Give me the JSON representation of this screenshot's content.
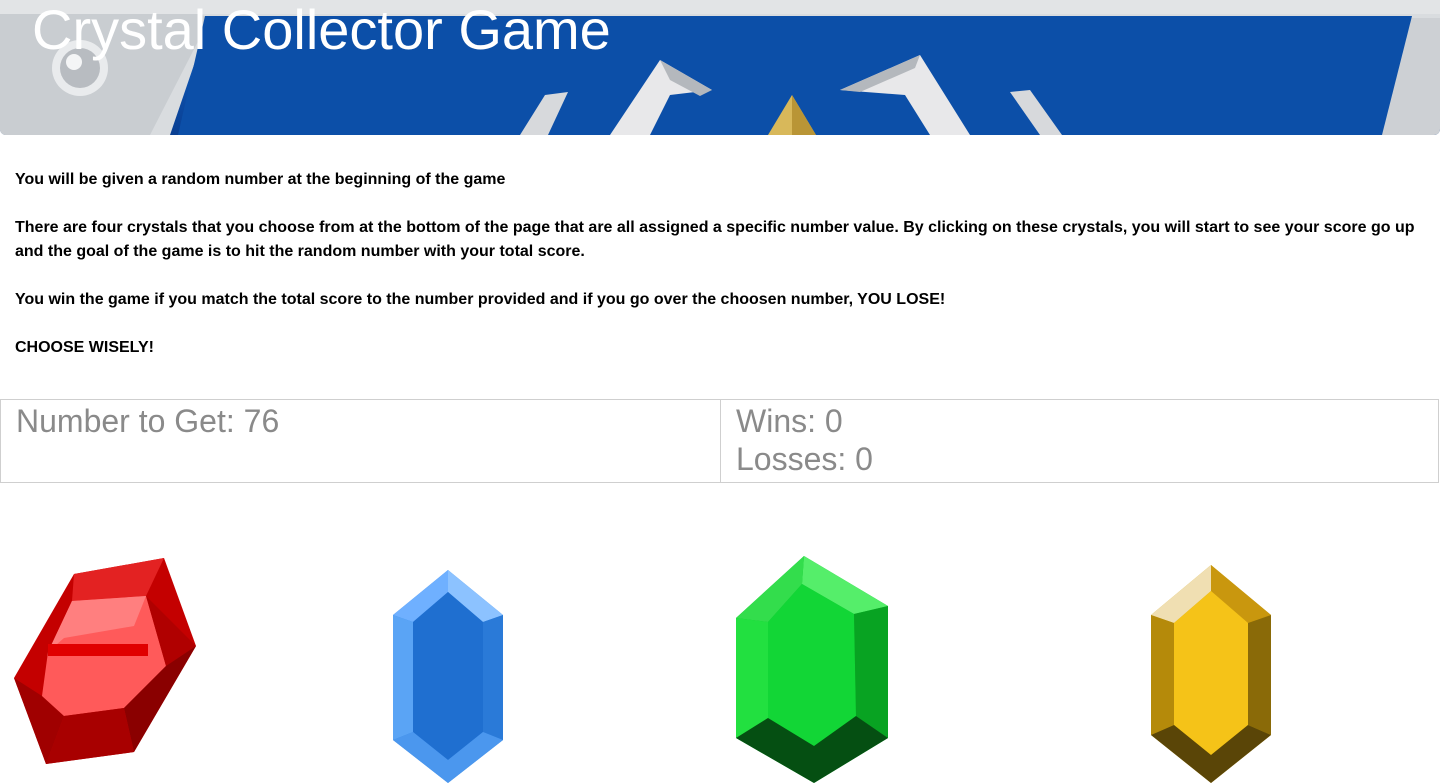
{
  "header": {
    "title": "Crystal Collector Game"
  },
  "instructions": [
    "You will be given a random number at the beginning of the game",
    "There are four crystals that you choose from at the bottom of the page that are all assigned a specific number value. By clicking on these crystals, you will start to see your score go up and the goal of the game is to hit the random number with your total score.",
    "You win the game if you match the total score to the number provided and if you go over the choosen number, YOU LOSE!",
    "CHOOSE WISELY!"
  ],
  "scoreboard": {
    "target_label": "Number to Get: 76",
    "wins_label": "Wins: 0",
    "losses_label": "Losses: 0"
  },
  "crystals": [
    {
      "name": "red-crystal",
      "color": "#d40000"
    },
    {
      "name": "blue-crystal",
      "color": "#2f86e6"
    },
    {
      "name": "green-crystal",
      "color": "#0ccf2a"
    },
    {
      "name": "yellow-crystal",
      "color": "#d4a70a"
    }
  ],
  "colors": {
    "banner_blue": "#0d57b6",
    "text_gray": "#8a8a8a",
    "border": "#cfcfcf"
  }
}
